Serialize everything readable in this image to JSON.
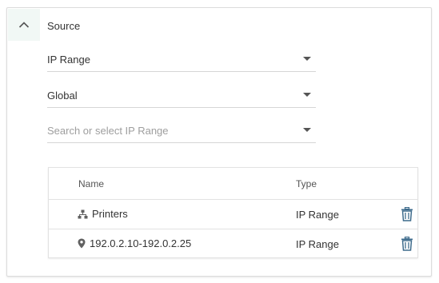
{
  "section": {
    "title": "Source"
  },
  "selects": [
    {
      "value": "IP Range",
      "is_placeholder": false
    },
    {
      "value": "Global",
      "is_placeholder": false
    },
    {
      "value": "Search or select IP Range",
      "is_placeholder": true
    }
  ],
  "table": {
    "columns": [
      "Name",
      "Type"
    ],
    "rows": [
      {
        "icon": "network-icon",
        "name": "Printers",
        "type": "IP Range"
      },
      {
        "icon": "location-pin-icon",
        "name": "192.0.2.10-192.0.2.25",
        "type": "IP Range"
      }
    ]
  },
  "colors": {
    "accent_bg": "#f1f8f5",
    "trash_icon": "#3d6b8c",
    "border": "#e2e2e2"
  }
}
